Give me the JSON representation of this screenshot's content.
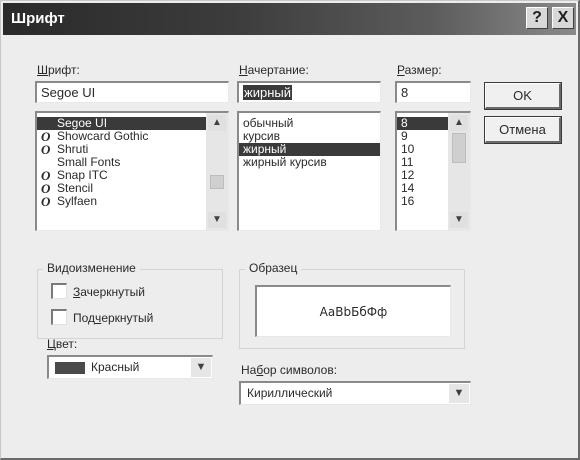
{
  "window": {
    "title": "Шрифт",
    "help_glyph": "?",
    "close_glyph": "X"
  },
  "font": {
    "label_key": "Ш",
    "label_rest": "рифт:",
    "value": "Segoe UI",
    "items": [
      {
        "name": "Segoe UI",
        "glyph": "",
        "selected": true
      },
      {
        "name": "Showcard Gothic",
        "glyph": "O",
        "selected": false
      },
      {
        "name": "Shruti",
        "glyph": "O",
        "selected": false
      },
      {
        "name": "Small Fonts",
        "glyph": "",
        "selected": false
      },
      {
        "name": "Snap ITC",
        "glyph": "O",
        "selected": false
      },
      {
        "name": "Stencil",
        "glyph": "O",
        "selected": false
      },
      {
        "name": "Sylfaen",
        "glyph": "O",
        "selected": false
      }
    ]
  },
  "style": {
    "label_key": "Н",
    "label_rest": "ачертание:",
    "value": "жирный",
    "items": [
      {
        "name": "обычный",
        "selected": false
      },
      {
        "name": "курсив",
        "selected": false
      },
      {
        "name": "жирный",
        "selected": true
      },
      {
        "name": "жирный курсив",
        "selected": false
      }
    ]
  },
  "size": {
    "label_key": "Р",
    "label_rest": "азмер:",
    "value": "8",
    "items": [
      {
        "name": "8",
        "selected": true
      },
      {
        "name": "9",
        "selected": false
      },
      {
        "name": "10",
        "selected": false
      },
      {
        "name": "11",
        "selected": false
      },
      {
        "name": "12",
        "selected": false
      },
      {
        "name": "14",
        "selected": false
      },
      {
        "name": "16",
        "selected": false
      }
    ]
  },
  "buttons": {
    "ok": "OK",
    "cancel": "Отмена"
  },
  "effects": {
    "title": "Видоизменение",
    "strike_key": "З",
    "strike_rest": "ачеркнутый",
    "strike_checked": false,
    "underline_pre": "Под",
    "underline_key": "ч",
    "underline_rest": "еркнутый",
    "underline_checked": false,
    "color_label_key": "Ц",
    "color_label_rest": "вет:",
    "color_value": "Красный",
    "color_swatch": "#4a4a4a"
  },
  "sample": {
    "title": "Образец",
    "text": "AaBbБбФф"
  },
  "charset": {
    "label_pre": "На",
    "label_key": "б",
    "label_rest": "ор символов:",
    "value": "Кириллический"
  }
}
